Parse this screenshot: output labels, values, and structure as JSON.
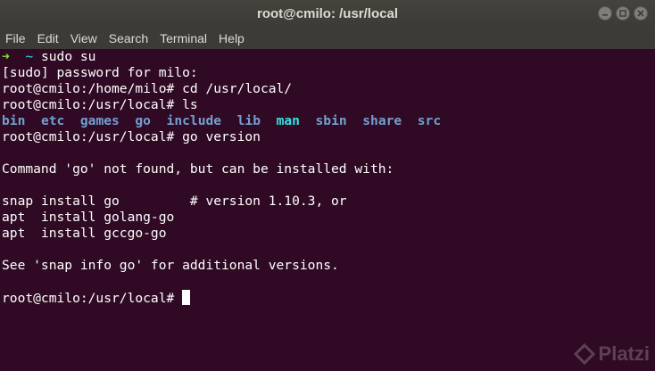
{
  "window": {
    "title": "root@cmilo: /usr/local"
  },
  "menu": {
    "items": [
      "File",
      "Edit",
      "View",
      "Search",
      "Terminal",
      "Help"
    ]
  },
  "terminal": {
    "line1": {
      "arrow": "➜",
      "tilde": "~",
      "command": "sudo su"
    },
    "line2": "[sudo] password for milo:",
    "line3": "root@cmilo:/home/milo# cd /usr/local/",
    "line4": "root@cmilo:/usr/local# ls",
    "ls_output": [
      "bin",
      "etc",
      "games",
      "go",
      "include",
      "lib",
      "man",
      "sbin",
      "share",
      "src"
    ],
    "line6": "root@cmilo:/usr/local# go version",
    "line8": "Command 'go' not found, but can be installed with:",
    "line10": "snap install go         # version 1.10.3, or",
    "line11": "apt  install golang-go",
    "line12": "apt  install gccgo-go",
    "line14": "See 'snap info go' for additional versions.",
    "prompt": "root@cmilo:/usr/local# "
  },
  "watermark": {
    "text": "Platzi"
  },
  "colors": {
    "background": "#300a24",
    "titlebar": "#3c3b37",
    "text": "#ffffff",
    "arrow": "#8ae234",
    "directory": "#729fcf",
    "special_directory": "#34e2e2"
  }
}
